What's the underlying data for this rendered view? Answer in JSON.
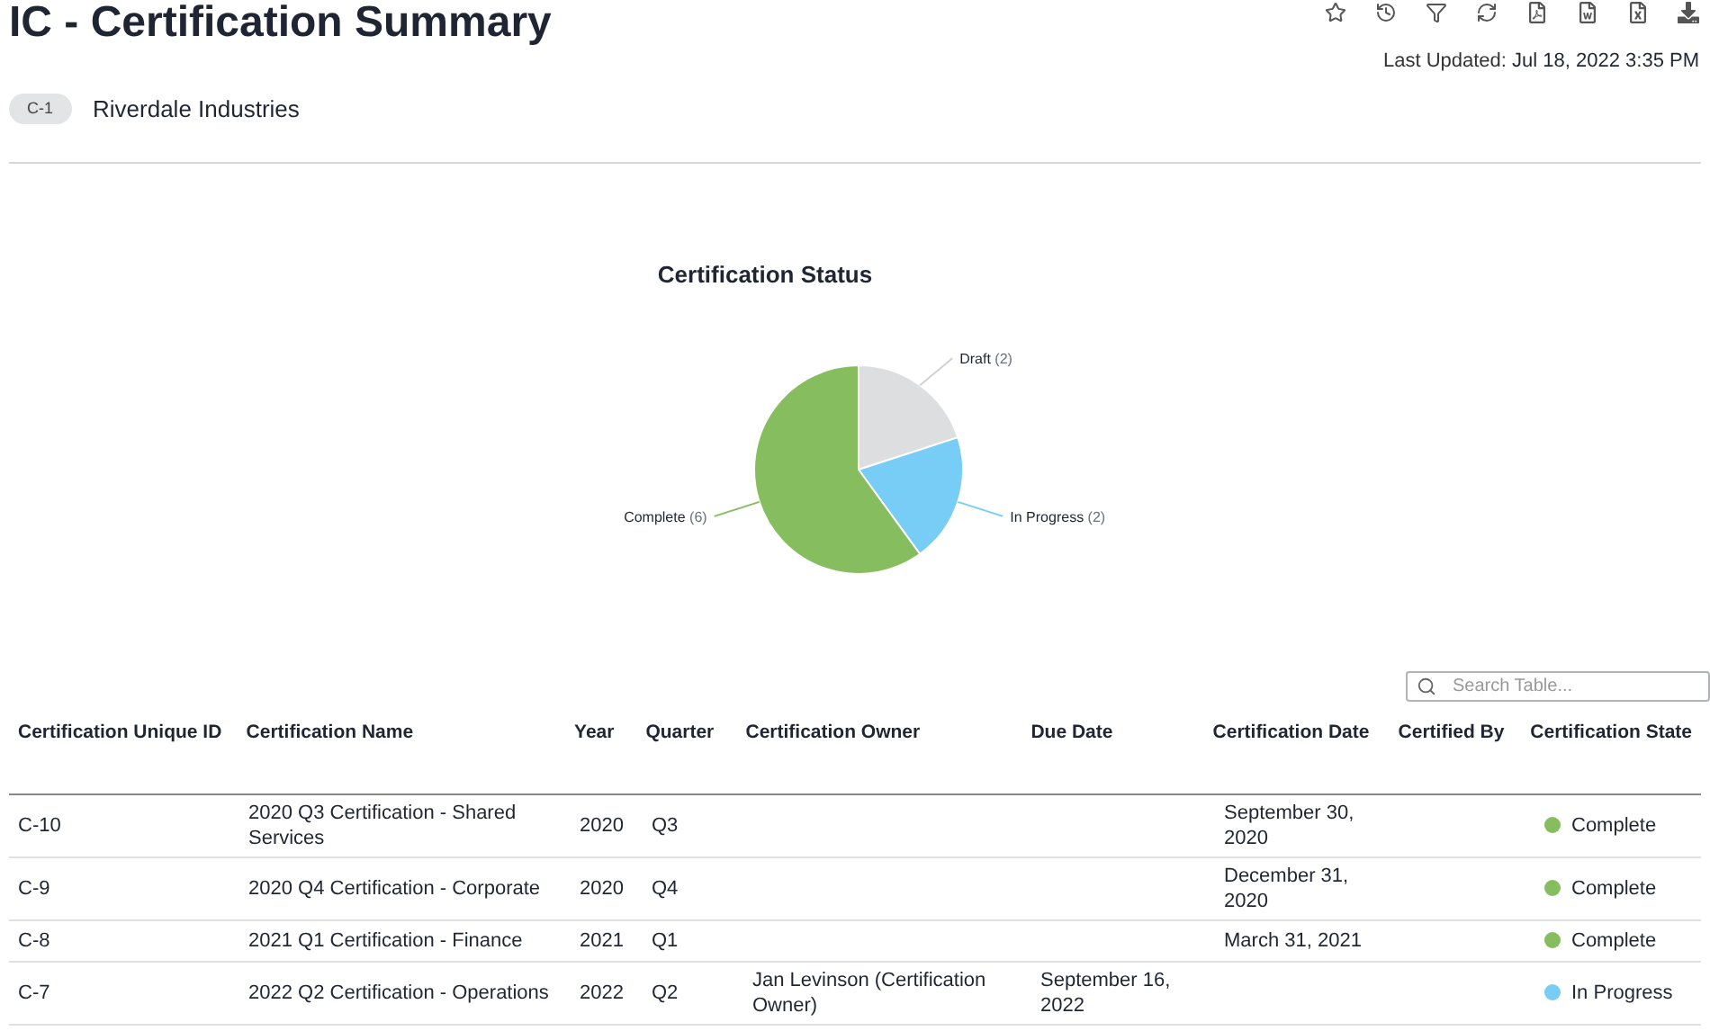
{
  "page": {
    "title": "IC - Certification Summary",
    "last_updated_label": "Last Updated:",
    "last_updated_value": "Jul 18, 2022 3:35 PM",
    "tag": "C-1",
    "entity": "Riverdale Industries"
  },
  "toolbar": [
    {
      "kind": "favorite"
    },
    {
      "kind": "history"
    },
    {
      "kind": "filter"
    },
    {
      "kind": "refresh"
    },
    {
      "kind": "pdf"
    },
    {
      "kind": "word"
    },
    {
      "kind": "excel"
    },
    {
      "kind": "download"
    }
  ],
  "chart": {
    "chart_data": {
      "type": "pie",
      "title": "Certification Status",
      "categories": [
        "Draft",
        "In Progress",
        "Complete"
      ],
      "values": [
        2,
        2,
        6
      ],
      "colors": [
        "#dcdee0",
        "#77cdf6",
        "#86bd5e"
      ],
      "value_labels": [
        "(2)",
        "(2)",
        "(6)"
      ]
    }
  },
  "search": {
    "placeholder": "Search Table..."
  },
  "table": {
    "columns": [
      "Certification Unique ID",
      "Certification Name",
      "Year",
      "Quarter",
      "Certification Owner",
      "Due Date",
      "Certification Date",
      "Certified By",
      "Certification State"
    ],
    "rows": [
      {
        "id": "C-10",
        "name": "2020 Q3 Certification - Shared Services",
        "year": "2020",
        "quarter": "Q3",
        "owner": "",
        "due": "",
        "cert_date": "September 30, 2020",
        "certified_by": "",
        "state": "Complete",
        "color": "#86bd5e"
      },
      {
        "id": "C-9",
        "name": "2020 Q4 Certification - Corporate",
        "year": "2020",
        "quarter": "Q4",
        "owner": "",
        "due": "",
        "cert_date": "December 31, 2020",
        "certified_by": "",
        "state": "Complete",
        "color": "#86bd5e"
      },
      {
        "id": "C-8",
        "name": "2021 Q1 Certification - Finance",
        "year": "2021",
        "quarter": "Q1",
        "owner": "",
        "due": "",
        "cert_date": "March 31, 2021",
        "certified_by": "",
        "state": "Complete",
        "color": "#86bd5e"
      },
      {
        "id": "C-7",
        "name": "2022 Q2 Certification - Operations",
        "year": "2022",
        "quarter": "Q2",
        "owner": "Jan Levinson (Certification Owner)",
        "due": "September 16, 2022",
        "cert_date": "",
        "certified_by": "",
        "state": "In Progress",
        "color": "#77cdf6"
      }
    ]
  }
}
